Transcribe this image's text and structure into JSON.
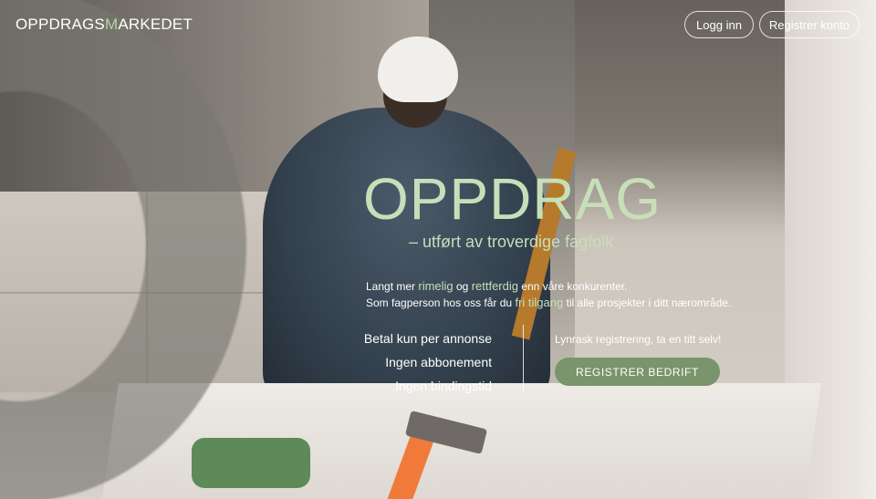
{
  "header": {
    "logo_part1": "OPPDRAGS",
    "logo_part2": "M",
    "logo_part3": "ARKEDET",
    "login_label": "Logg inn",
    "register_label": "Registrer konto"
  },
  "hero": {
    "title": "OPPDRAG",
    "subtitle": "– utført av troverdige fagfolk",
    "intro_line1_a": "Langt mer ",
    "intro_line1_hl1": "rimelig",
    "intro_line1_b": " og ",
    "intro_line1_hl2": "rettferdig",
    "intro_line1_c": " enn våre konkurenter.",
    "intro_line2_a": "Som fagperson hos oss får du ",
    "intro_line2_hl": "fri tilgang",
    "intro_line2_b": " til alle prosjekter i ditt nærområde."
  },
  "features": [
    "Betal kun per annonse",
    "Ingen abbonement",
    "Ingen bindingstid"
  ],
  "cta": {
    "text": "Lynrask registrering, ta en titt selv!",
    "button_label": "REGISTRER BEDRIFT"
  },
  "colors": {
    "accent_green": "#c7dfb9",
    "button_green": "#7a946b"
  }
}
